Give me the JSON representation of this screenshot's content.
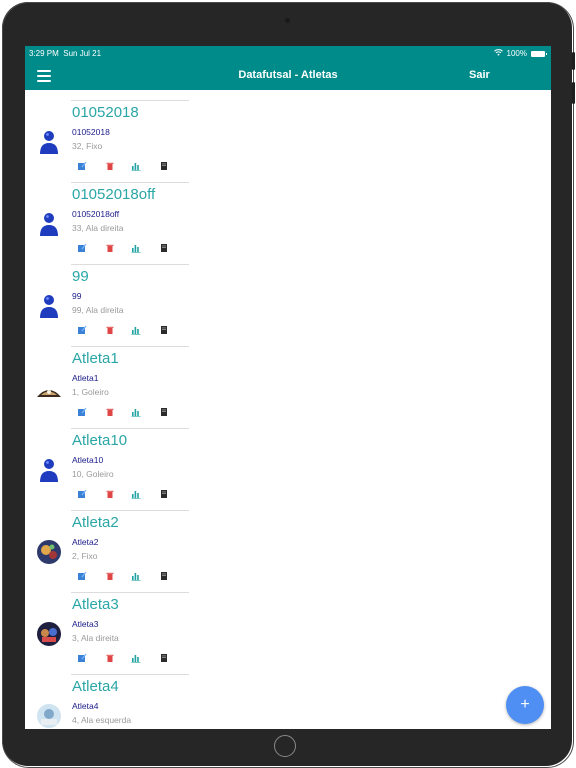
{
  "status_bar": {
    "time": "3:29 PM",
    "date": "Sun Jul 21",
    "wifi_icon": "wifi-icon",
    "battery": "100%"
  },
  "nav": {
    "title": "Datafutsal - Atletas",
    "logout_label": "Sair",
    "menu_icon": "hamburger-menu-icon"
  },
  "colors": {
    "nav_background": "#008b8b",
    "athlete_name": "#2aa6a6",
    "username": "#1b1b8a",
    "detail": "#9a9a9a",
    "fab": "#4f8ef2"
  },
  "athletes": [
    {
      "name": "01052018",
      "username": "01052018",
      "detail": "32, Fixo",
      "avatar": "default-user-icon"
    },
    {
      "name": "01052018off",
      "username": "01052018off",
      "detail": "33, Ala direita",
      "avatar": "default-user-icon"
    },
    {
      "name": "99",
      "username": "99",
      "detail": "99, Ala direita",
      "avatar": "default-user-icon"
    },
    {
      "name": "Atleta1",
      "username": "Atleta1",
      "detail": "1, Goleiro",
      "avatar": "photo-avatar"
    },
    {
      "name": "Atleta10",
      "username": "Atleta10",
      "detail": "10, Goleiro",
      "avatar": "default-user-icon"
    },
    {
      "name": "Atleta2",
      "username": "Atleta2",
      "detail": "2, Fixo",
      "avatar": "photo-avatar"
    },
    {
      "name": "Atleta3",
      "username": "Atleta3",
      "detail": "3, Ala direita",
      "avatar": "photo-avatar"
    },
    {
      "name": "Atleta4",
      "username": "Atleta4",
      "detail": "4, Ala esquerda",
      "avatar": "photo-avatar"
    }
  ],
  "row_actions": [
    "edit-icon",
    "delete-icon",
    "stats-icon",
    "report-icon"
  ],
  "fab": {
    "label": "+",
    "icon": "add-icon"
  }
}
